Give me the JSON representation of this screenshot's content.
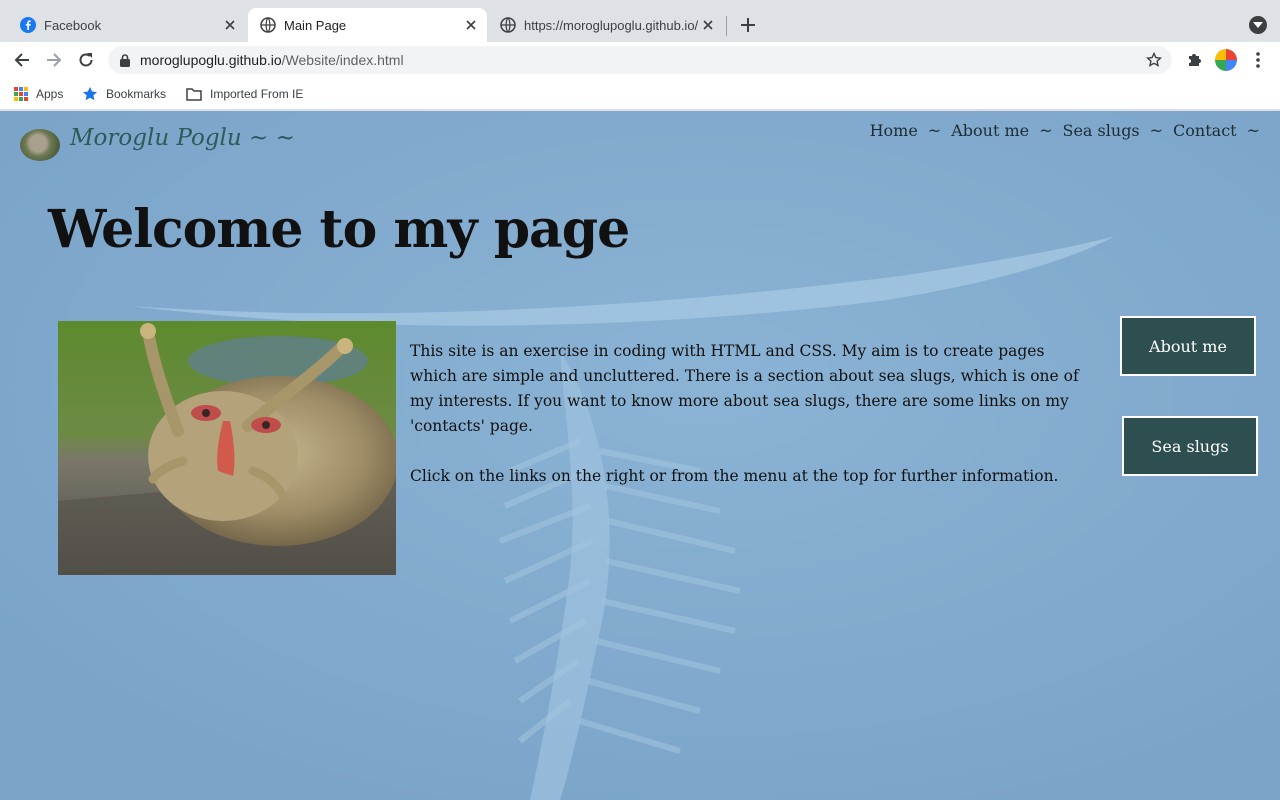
{
  "browser": {
    "tabs": [
      {
        "title": "Facebook",
        "icon": "facebook-icon",
        "active": false
      },
      {
        "title": "Main Page",
        "icon": "globe-icon",
        "active": true
      },
      {
        "title": "https://moroglupoglu.github.io/",
        "icon": "globe-icon",
        "active": false
      }
    ],
    "address": {
      "host": "moroglupoglu.github.io",
      "path": "/Website/index.html"
    },
    "bookmarks": [
      {
        "label": "Apps",
        "icon": "apps-grid-icon"
      },
      {
        "label": "Bookmarks",
        "icon": "star-icon"
      },
      {
        "label": "Imported From IE",
        "icon": "folder-icon"
      }
    ]
  },
  "site": {
    "name": "Moroglu Poglu ~ ~",
    "nav": [
      {
        "label": "Home"
      },
      {
        "label": "About me"
      },
      {
        "label": "Sea slugs"
      },
      {
        "label": "Contact"
      }
    ],
    "nav_separator": "~",
    "heading": "Welcome to my page",
    "paragraphs": [
      "This site is an exercise in coding with HTML and CSS. My aim is to create pages which are simple and uncluttered. There is a section about sea slugs, which is one of my interests. If you want to know more about sea slugs, there are some links on my 'contacts' page.",
      "Click on the links on the right or from the menu at the top for further information."
    ],
    "side_buttons": [
      {
        "label": "About me"
      },
      {
        "label": "Sea slugs"
      }
    ]
  },
  "colors": {
    "page_background": "#7da7cc",
    "button_background": "#2d4f50",
    "site_name": "#2f5a5a"
  }
}
